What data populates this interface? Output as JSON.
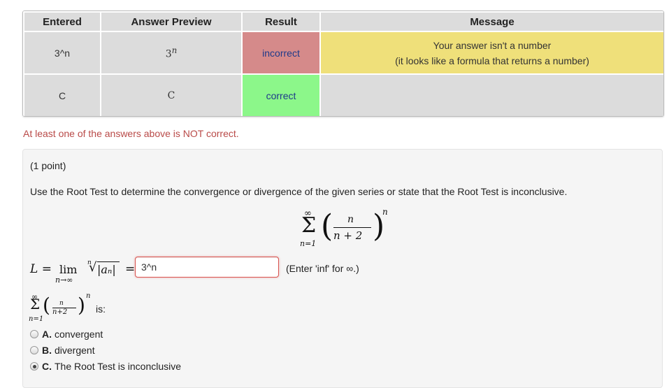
{
  "results_table": {
    "headers": [
      "Entered",
      "Answer Preview",
      "Result",
      "Message"
    ],
    "rows": [
      {
        "entered": "3^n",
        "preview_base": "3",
        "preview_exp": "n",
        "result": "incorrect",
        "message_line1": "Your answer isn't a number",
        "message_line2": "(it looks like a formula that returns a number)"
      },
      {
        "entered": "C",
        "preview": "C",
        "result": "correct",
        "message": ""
      }
    ]
  },
  "alert_text": "At least one of the answers above is NOT correct.",
  "problem": {
    "points": "(1 point)",
    "instruction": "Use the Root Test to determine the convergence or divergence of the given series or state that the Root Test is inconclusive.",
    "series": {
      "sum_top": "∞",
      "sum_symbol": "Σ",
      "sum_bottom": "n=1",
      "numerator": "n",
      "denominator": "n + 2",
      "exponent": "n"
    },
    "limit_row": {
      "L_eq": "L =",
      "lim": "lim",
      "lim_sub": "n→∞",
      "root_index": "n",
      "root_symbol": "√",
      "abs_expr": "|aₙ|",
      "equals": "=",
      "answer_value": "3^n",
      "hint": "(Enter 'inf' for ∞.)"
    },
    "small_series": {
      "sum_top": "∞",
      "sum_symbol": "Σ",
      "sum_bottom": "n=1",
      "numerator": "n",
      "denominator": "n+2",
      "exponent": "n",
      "suffix": "is:"
    },
    "options": [
      {
        "letter": "A.",
        "text": "convergent",
        "checked": false
      },
      {
        "letter": "B.",
        "text": "divergent",
        "checked": false
      },
      {
        "letter": "C.",
        "text": "The Root Test is inconclusive",
        "checked": true
      }
    ]
  }
}
